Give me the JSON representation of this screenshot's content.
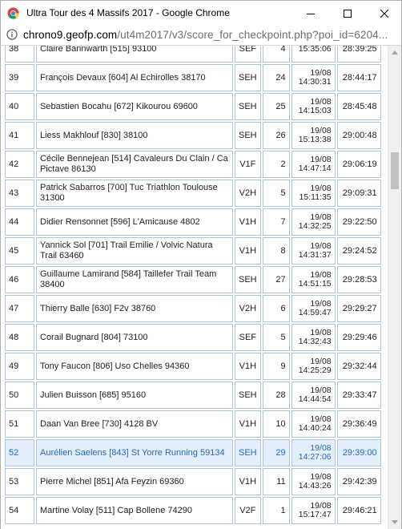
{
  "window": {
    "title": "Ultra Tour des 4 Massifs 2017 - Google Chrome"
  },
  "address": {
    "host": "chrono9.geofp.com",
    "path": "/ut4m2017/v3/score_for_checkpoint.php?poi_id=6204..."
  },
  "rows": [
    {
      "rank": "38",
      "name": "Claire Bannwarth [515] 93100",
      "cat": "SEF",
      "pos": "4",
      "date": "",
      "time": "15:35:06",
      "total": "28:39:25"
    },
    {
      "rank": "39",
      "name": "François Devaux [604] Al Echirolles 38170",
      "cat": "SEH",
      "pos": "24",
      "date": "19/08",
      "time": "14:30:31",
      "total": "28:44:17"
    },
    {
      "rank": "40",
      "name": "Sebastien Bocahu [672] Kikourou 69600",
      "cat": "SEH",
      "pos": "25",
      "date": "19/08",
      "time": "14:15:03",
      "total": "28:45:48"
    },
    {
      "rank": "41",
      "name": "Liess Makhlouf [830] 38100",
      "cat": "SEH",
      "pos": "26",
      "date": "19/08",
      "time": "15:13:38",
      "total": "29:00:48"
    },
    {
      "rank": "42",
      "name": "Cécile Bennejean [514] Cavaleurs Du Clain / Ca Pictave 86130",
      "cat": "V1F",
      "pos": "2",
      "date": "19/08",
      "time": "14:47:14",
      "total": "29:06:19"
    },
    {
      "rank": "43",
      "name": "Patrick Sabarros [700] Tuc Triathlon Toulouse 31300",
      "cat": "V2H",
      "pos": "5",
      "date": "19/08",
      "time": "15:11:35",
      "total": "29:09:31"
    },
    {
      "rank": "44",
      "name": "Didier Rensonnet [596] L'Amicause 4802",
      "cat": "V1H",
      "pos": "7",
      "date": "19/08",
      "time": "14:32:25",
      "total": "29:22:50"
    },
    {
      "rank": "45",
      "name": "Yannick Sol [701] Trail Emilie / Volvic Natura Trail 63460",
      "cat": "V1H",
      "pos": "8",
      "date": "19/08",
      "time": "14:31:37",
      "total": "29:24:52"
    },
    {
      "rank": "46",
      "name": "Guillaume Lamirand [584] Taillefer Trail Team 38400",
      "cat": "SEH",
      "pos": "27",
      "date": "19/08",
      "time": "14:51:15",
      "total": "29:28:53"
    },
    {
      "rank": "47",
      "name": "Thierry Balle [630] F2v 38760",
      "cat": "V2H",
      "pos": "6",
      "date": "19/08",
      "time": "14:59:47",
      "total": "29:29:27"
    },
    {
      "rank": "48",
      "name": "Corail Bugnard [804] 73100",
      "cat": "SEF",
      "pos": "5",
      "date": "19/08",
      "time": "14:32:43",
      "total": "29:29:46"
    },
    {
      "rank": "49",
      "name": "Tony Faucon [806] Uso Chelles 94360",
      "cat": "V1H",
      "pos": "9",
      "date": "19/08",
      "time": "14:25:29",
      "total": "29:32:44"
    },
    {
      "rank": "50",
      "name": "Julien Buisson [685] 95160",
      "cat": "SEH",
      "pos": "28",
      "date": "19/08",
      "time": "14:44:54",
      "total": "29:33:47"
    },
    {
      "rank": "51",
      "name": "Daan Van Bree [730] 4128 BV",
      "cat": "V1H",
      "pos": "10",
      "date": "19/08",
      "time": "14:40:24",
      "total": "29:36:49"
    },
    {
      "rank": "52",
      "name": "Aurélien Saelens [843] St Yorre Running 59134",
      "cat": "SEH",
      "pos": "29",
      "date": "19/08",
      "time": "14:27:06",
      "total": "29:39:00",
      "highlight": true
    },
    {
      "rank": "53",
      "name": "Pierre Michel [851] Afa Feyzin 69360",
      "cat": "V1H",
      "pos": "11",
      "date": "19/08",
      "time": "14:43:26",
      "total": "29:42:39"
    },
    {
      "rank": "54",
      "name": "Martine Volay [511] Cap Bollene 74290",
      "cat": "V2F",
      "pos": "1",
      "date": "19/08",
      "time": "15:17:47",
      "total": "29:46:21"
    }
  ]
}
